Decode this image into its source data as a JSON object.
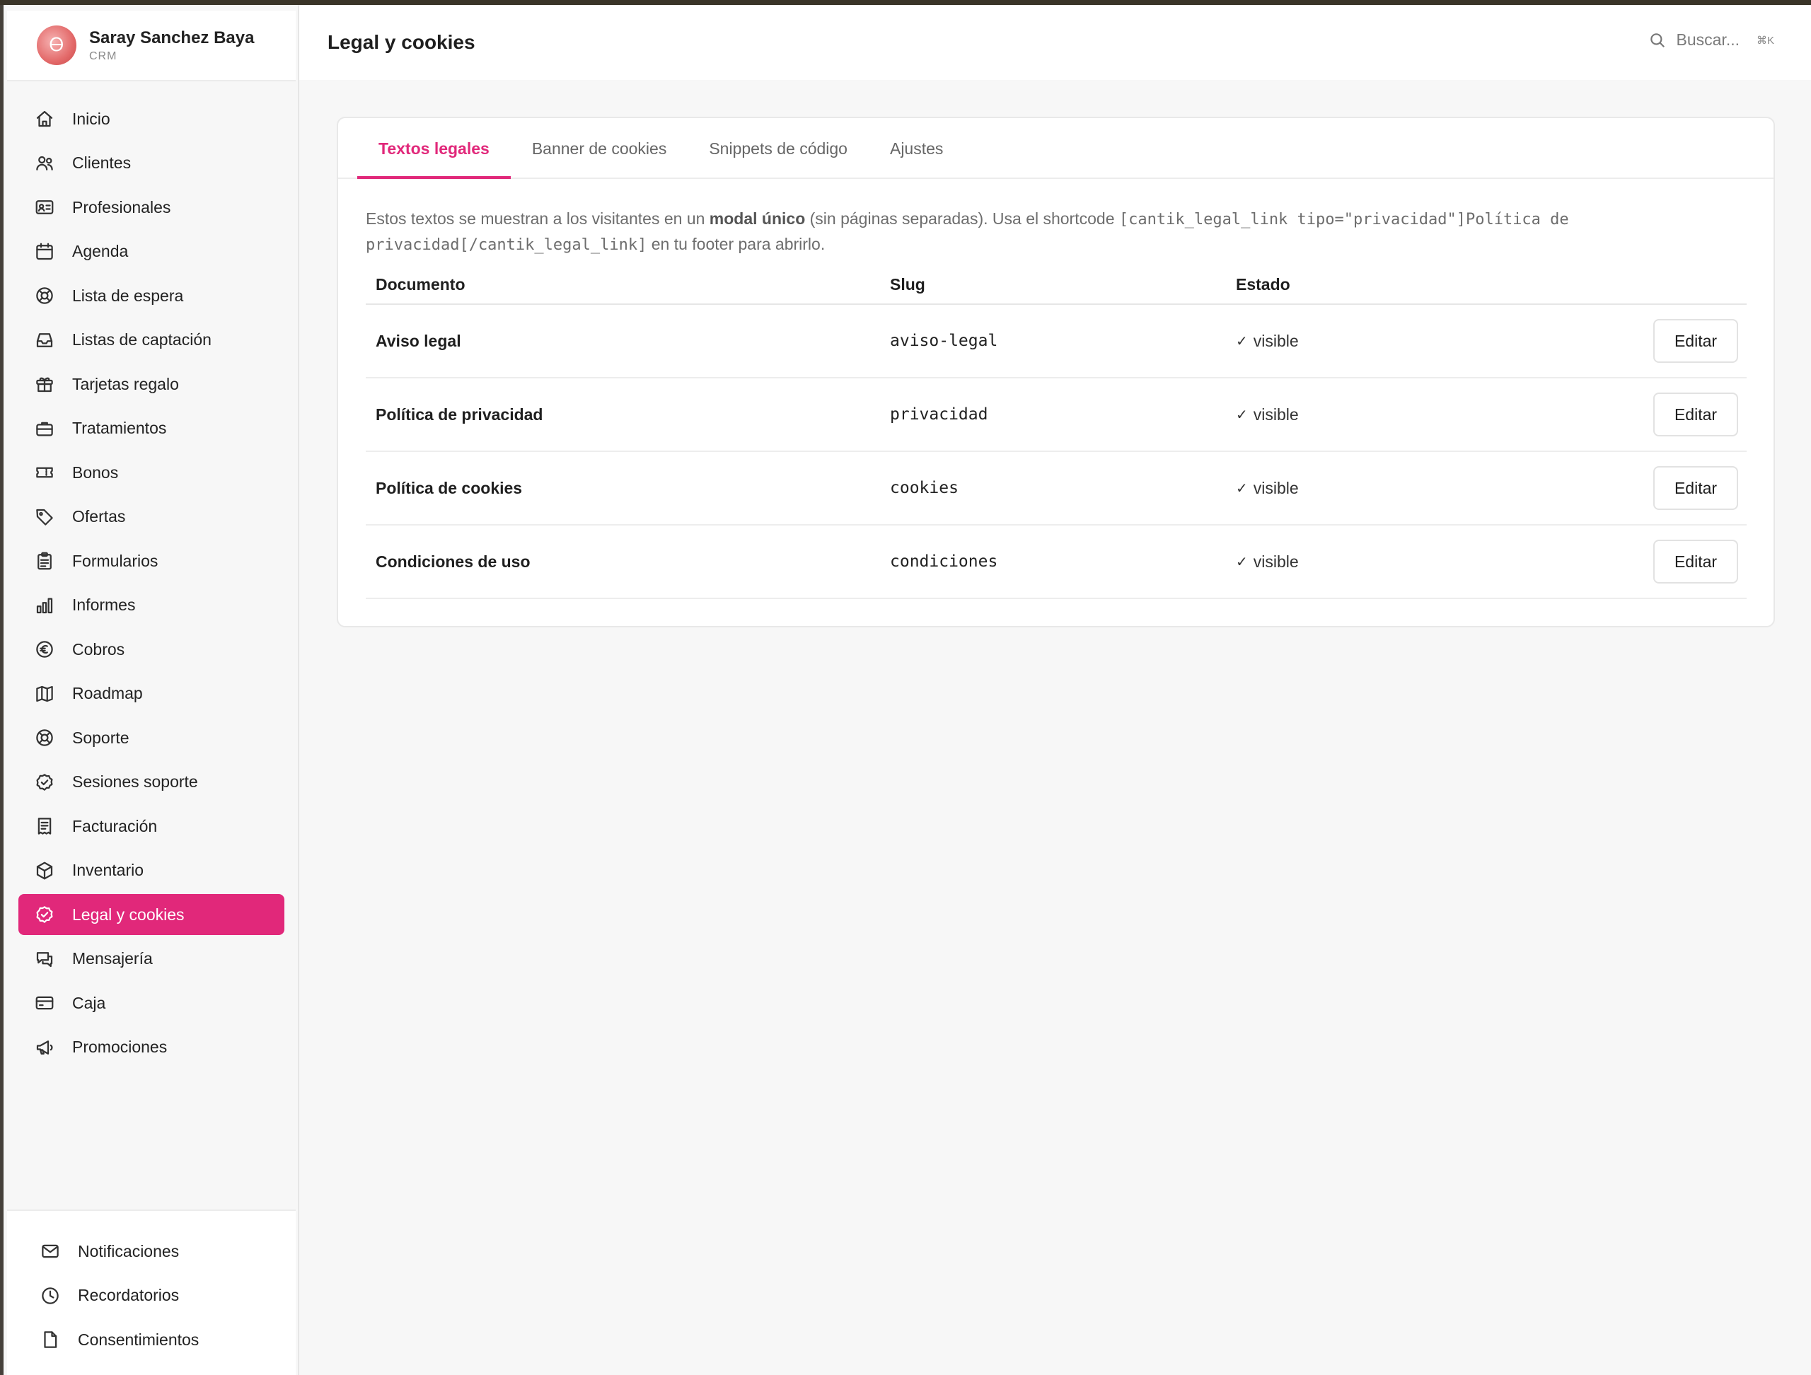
{
  "sidebar": {
    "profile": {
      "avatar_glyph": "Ꮎ",
      "name": "Saray Sanchez Baya",
      "subtitle": "CRM"
    },
    "items": [
      {
        "label": "Inicio",
        "icon": "home-icon"
      },
      {
        "label": "Clientes",
        "icon": "users-icon"
      },
      {
        "label": "Profesionales",
        "icon": "id-card-icon"
      },
      {
        "label": "Agenda",
        "icon": "calendar-icon"
      },
      {
        "label": "Lista de espera",
        "icon": "lifebuoy-icon"
      },
      {
        "label": "Listas de captación",
        "icon": "inbox-icon"
      },
      {
        "label": "Tarjetas regalo",
        "icon": "gift-icon"
      },
      {
        "label": "Tratamientos",
        "icon": "briefcase-icon"
      },
      {
        "label": "Bonos",
        "icon": "ticket-icon"
      },
      {
        "label": "Ofertas",
        "icon": "tag-icon"
      },
      {
        "label": "Formularios",
        "icon": "clipboard-icon"
      },
      {
        "label": "Informes",
        "icon": "bar-chart-icon"
      },
      {
        "label": "Cobros",
        "icon": "euro-icon"
      },
      {
        "label": "Roadmap",
        "icon": "map-icon"
      },
      {
        "label": "Soporte",
        "icon": "lifebuoy-icon"
      },
      {
        "label": "Sesiones soporte",
        "icon": "badge-check-icon"
      },
      {
        "label": "Facturación",
        "icon": "receipt-icon"
      },
      {
        "label": "Inventario",
        "icon": "box-icon"
      },
      {
        "label": "Legal y cookies",
        "icon": "badge-check-icon",
        "active": true
      },
      {
        "label": "Mensajería",
        "icon": "chat-icon"
      },
      {
        "label": "Caja",
        "icon": "credit-card-icon"
      },
      {
        "label": "Promociones",
        "icon": "megaphone-icon"
      }
    ],
    "bottom_items": [
      {
        "label": "Notificaciones",
        "icon": "mail-icon"
      },
      {
        "label": "Recordatorios",
        "icon": "clock-icon"
      },
      {
        "label": "Consentimientos",
        "icon": "file-icon"
      }
    ]
  },
  "header": {
    "title": "Legal y cookies",
    "search_placeholder": "Buscar...",
    "search_shortcut": "⌘K"
  },
  "tabs": [
    {
      "label": "Textos legales",
      "active": true
    },
    {
      "label": "Banner de cookies"
    },
    {
      "label": "Snippets de código"
    },
    {
      "label": "Ajustes"
    }
  ],
  "description": {
    "part1": "Estos textos se muestran a los visitantes en un ",
    "bold": "modal único",
    "part2": " (sin páginas separadas). Usa el shortcode ",
    "code": "[cantik_legal_link tipo=\"privacidad\"]Política de privacidad[/cantik_legal_link]",
    "part3": " en tu footer para abrirlo."
  },
  "table": {
    "headers": {
      "documento": "Documento",
      "slug": "Slug",
      "estado": "Estado"
    },
    "rows": [
      {
        "documento": "Aviso legal",
        "slug": "aviso-legal",
        "estado": "visible",
        "action": "Editar"
      },
      {
        "documento": "Política de privacidad",
        "slug": "privacidad",
        "estado": "visible",
        "action": "Editar"
      },
      {
        "documento": "Política de cookies",
        "slug": "cookies",
        "estado": "visible",
        "action": "Editar"
      },
      {
        "documento": "Condiciones de uso",
        "slug": "condiciones",
        "estado": "visible",
        "action": "Editar"
      }
    ],
    "check_glyph": "✓"
  },
  "colors": {
    "accent": "#e1287a",
    "background": "#f7f7f7",
    "card": "#ffffff"
  }
}
